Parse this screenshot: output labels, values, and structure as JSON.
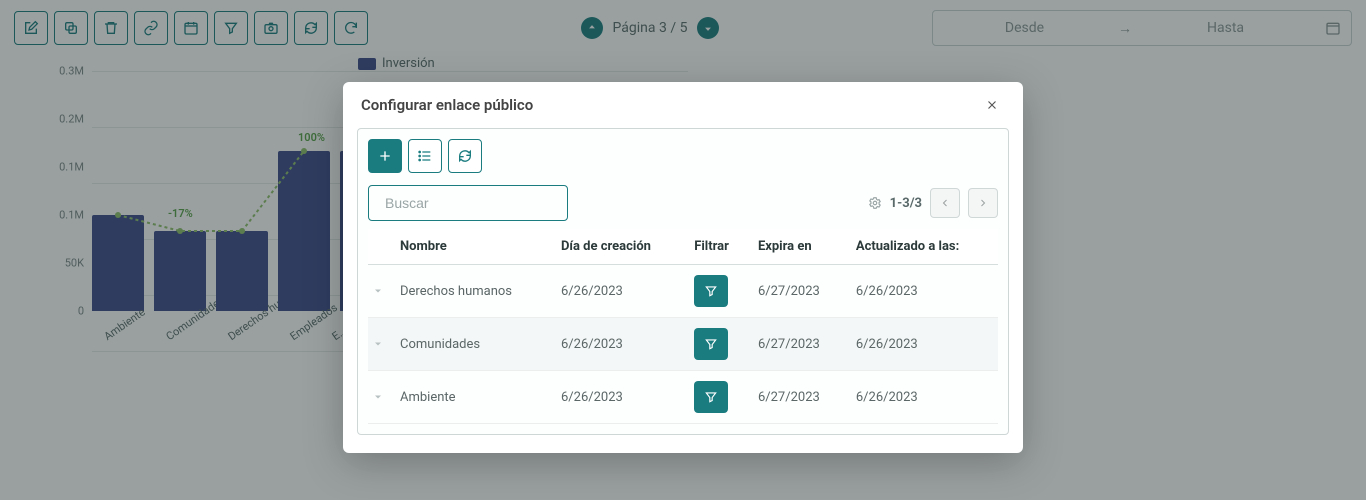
{
  "pager": {
    "label": "Página 3 / 5"
  },
  "daterange": {
    "from": "Desde",
    "to": "Hasta"
  },
  "legend": {
    "series": "Inversión"
  },
  "yticks": [
    "0.3M",
    "0.2M",
    "0.1M",
    "0.1M",
    "50K",
    "0"
  ],
  "bars": [
    {
      "label": "Ambiente",
      "value": 0.12
    },
    {
      "label": "Comunidades",
      "value": 0.1
    },
    {
      "label": "Derechos humanos",
      "value": 0.1
    },
    {
      "label": "Empleados",
      "value": 0.2
    },
    {
      "label": "E…",
      "value": 0.2
    }
  ],
  "percent_points": [
    {
      "idx": 0,
      "y": 0.12,
      "label": ""
    },
    {
      "idx": 1,
      "y": 0.1,
      "label": "-17%"
    },
    {
      "idx": 2,
      "y": 0.1,
      "label": ""
    },
    {
      "idx": 3,
      "y": 0.2,
      "label": "100%"
    }
  ],
  "modal": {
    "title": "Configurar enlace público",
    "search_placeholder": "Buscar",
    "page_info": "1-3/3",
    "columns": {
      "name": "Nombre",
      "created": "Día de creación",
      "filter": "Filtrar",
      "expires": "Expira en",
      "updated": "Actualizado a las:"
    },
    "rows": [
      {
        "name": "Derechos humanos",
        "created": "6/26/2023",
        "expires": "6/27/2023",
        "updated": "6/26/2023"
      },
      {
        "name": "Comunidades",
        "created": "6/26/2023",
        "expires": "6/27/2023",
        "updated": "6/26/2023"
      },
      {
        "name": "Ambiente",
        "created": "6/26/2023",
        "expires": "6/27/2023",
        "updated": "6/26/2023"
      }
    ]
  },
  "chart_data": {
    "type": "bar",
    "title": "",
    "series_name": "Inversión",
    "categories": [
      "Ambiente",
      "Comunidades",
      "Derechos humanos",
      "Empleados"
    ],
    "values_M": [
      0.12,
      0.1,
      0.1,
      0.2
    ],
    "pct_change": [
      null,
      -17,
      0,
      100
    ],
    "ylim": [
      0,
      0.3
    ],
    "ylabel": "",
    "xlabel": ""
  }
}
